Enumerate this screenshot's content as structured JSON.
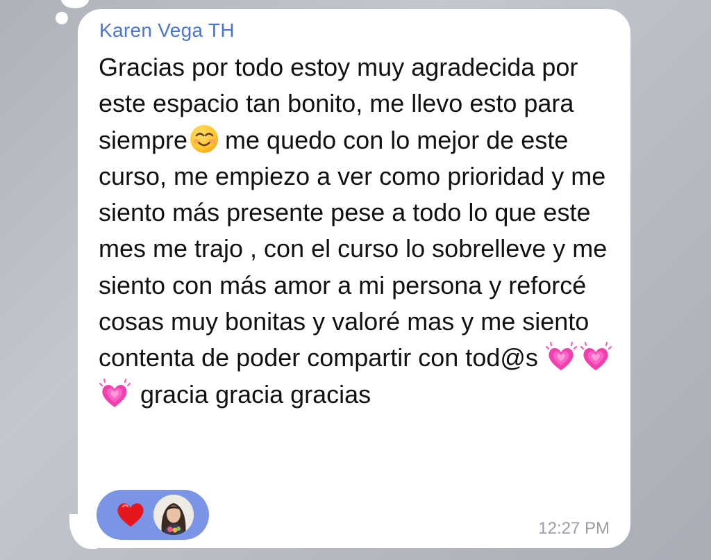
{
  "message": {
    "sender": "Karen Vega TH",
    "text_part1": "Gracias por todo estoy muy agradecida por este espacio tan bonito, me llevo esto para siempre",
    "text_part2": "me quedo con lo mejor de este curso, me empiezo a ver como prioridad y me siento más presente pese a todo lo que este mes me trajo , con el curso lo sobrelleve y me siento con más amor a mi persona y reforcé cosas muy bonitas y valoré mas y me siento contenta de poder compartir con tod@s ",
    "text_part3": "gracia gracia gracias",
    "inline_emojis": [
      "smiling-face-icon",
      "growing-heart-icon",
      "growing-heart-icon",
      "growing-heart-icon"
    ],
    "timestamp": "12:27 PM"
  },
  "reactions": {
    "emoji": "red-heart-icon",
    "reactor_avatar": "avatar",
    "pill_color": "#7a95e6"
  },
  "colors": {
    "sender_name": "#4a75d3",
    "bubble": "#ffffff",
    "message_text": "#111111",
    "timestamp": "#9a9da6"
  }
}
